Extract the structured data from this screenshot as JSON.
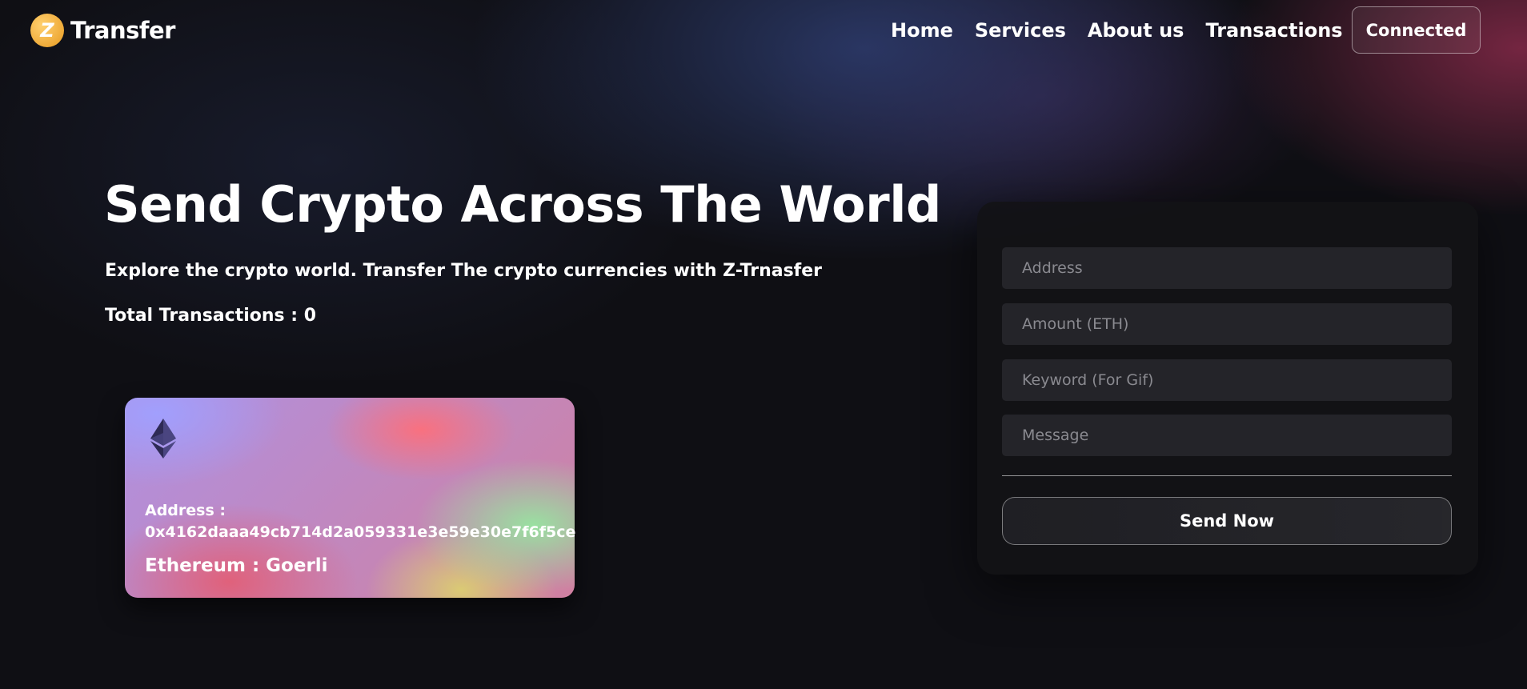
{
  "nav": {
    "logo_text": "Transfer",
    "logo_glyph": "Z",
    "links": [
      "Home",
      "Services",
      "About us",
      "Transactions"
    ],
    "connect_label": "Connected"
  },
  "hero": {
    "title": "Send Crypto Across The World",
    "subtitle": "Explore the crypto world. Transfer The crypto currencies with Z-Trnasfer",
    "total_transactions": "Total Transactions : 0"
  },
  "card": {
    "icon": "ethereum-icon",
    "address_label": "Address :",
    "address": "0x4162daaa49cb714d2a059331e3e59e30e7f6f5ce",
    "network": "Ethereum : Goerli"
  },
  "form": {
    "address_placeholder": "Address",
    "amount_placeholder": "Amount (ETH)",
    "keyword_placeholder": "Keyword (For Gif)",
    "message_placeholder": "Message",
    "send_label": "Send Now"
  }
}
